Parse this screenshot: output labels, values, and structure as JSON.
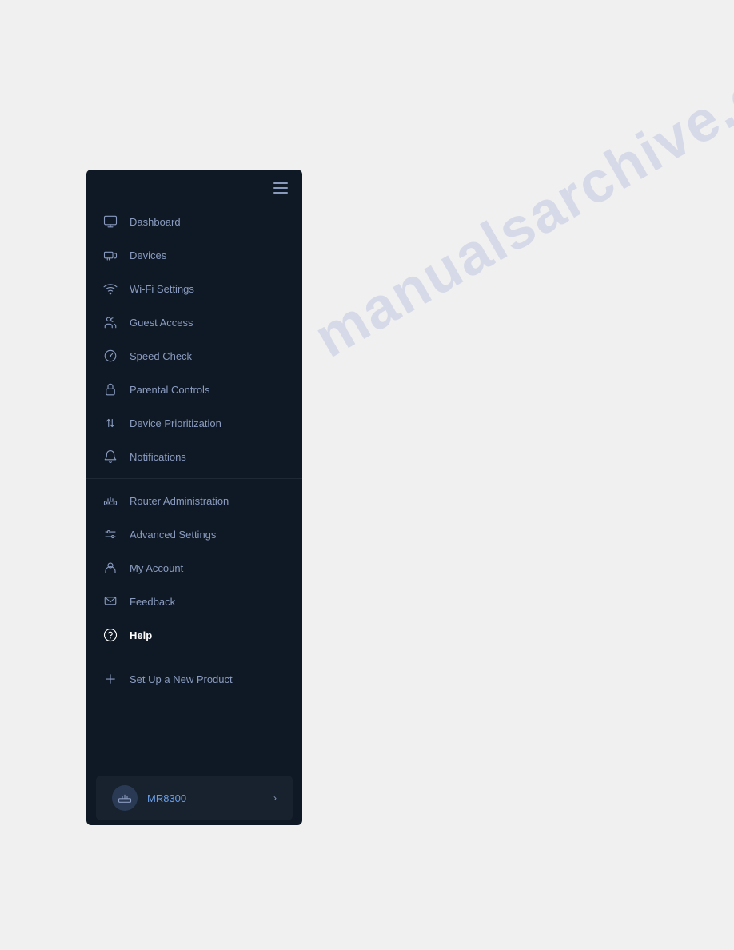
{
  "watermark": {
    "text": "manualsarchive.com"
  },
  "sidebar": {
    "nav_items": [
      {
        "id": "dashboard",
        "label": "Dashboard",
        "icon": "monitor"
      },
      {
        "id": "devices",
        "label": "Devices",
        "icon": "devices"
      },
      {
        "id": "wifi-settings",
        "label": "Wi-Fi Settings",
        "icon": "wifi"
      },
      {
        "id": "guest-access",
        "label": "Guest Access",
        "icon": "guest"
      },
      {
        "id": "speed-check",
        "label": "Speed Check",
        "icon": "speed"
      },
      {
        "id": "parental-controls",
        "label": "Parental Controls",
        "icon": "lock"
      },
      {
        "id": "device-prioritization",
        "label": "Device Prioritization",
        "icon": "priority"
      },
      {
        "id": "notifications",
        "label": "Notifications",
        "icon": "bell"
      },
      {
        "id": "router-administration",
        "label": "Router Administration",
        "icon": "router"
      },
      {
        "id": "advanced-settings",
        "label": "Advanced Settings",
        "icon": "settings"
      },
      {
        "id": "my-account",
        "label": "My Account",
        "icon": "account"
      },
      {
        "id": "feedback",
        "label": "Feedback",
        "icon": "feedback"
      },
      {
        "id": "help",
        "label": "Help",
        "icon": "help",
        "active": true
      },
      {
        "id": "setup-new-product",
        "label": "Set Up a New Product",
        "icon": "plus"
      }
    ],
    "device": {
      "name": "MR8300",
      "icon": "router-device"
    }
  }
}
